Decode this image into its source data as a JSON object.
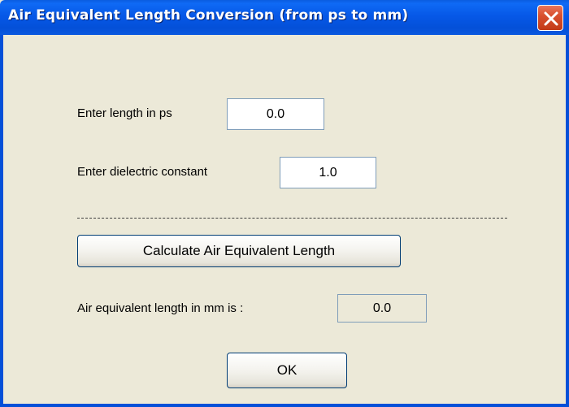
{
  "window": {
    "title": "Air Equivalent Length Conversion (from ps to mm)",
    "titlebar_color": "#0450d8",
    "close_icon": "close-icon"
  },
  "form": {
    "length_label": "Enter length in ps",
    "length_value": "0.0",
    "dielectric_label": "Enter dielectric constant",
    "dielectric_value": "1.0",
    "calculate_label": "Calculate Air Equivalent Length",
    "result_label": "Air equivalent length in mm is :",
    "result_value": "0.0",
    "ok_label": "OK"
  }
}
